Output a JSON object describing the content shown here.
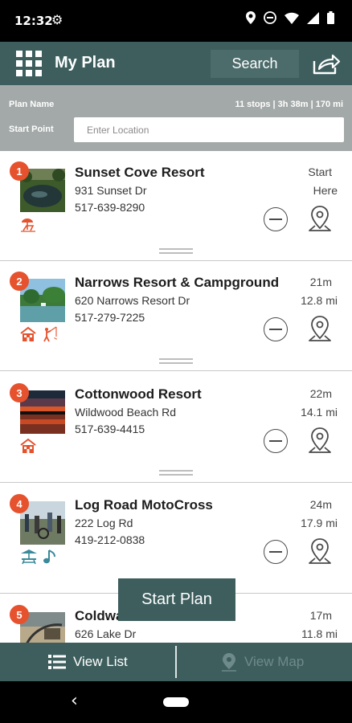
{
  "status_bar": {
    "time": "12:32",
    "icons": [
      "gear-icon",
      "location-icon",
      "do-not-disturb-icon",
      "wifi-icon",
      "signal-icon",
      "battery-icon"
    ]
  },
  "header": {
    "menu_icon": "grid-menu-icon",
    "title": "My Plan",
    "search_label": "Search",
    "share_icon": "share-icon"
  },
  "plan": {
    "name_label": "Plan Name",
    "stats": "11 stops | 3h 38m | 170 mi",
    "start_label": "Start Point",
    "start_placeholder": "Enter Location"
  },
  "stops": [
    {
      "number": "1",
      "name": "Sunset Cove Resort",
      "address": "931 Sunset Dr",
      "phone": "517-639-8290",
      "time": "Start",
      "distance": "Here",
      "amenities": [
        "beach-chair-icon"
      ],
      "amenity_color": "#e5522d"
    },
    {
      "number": "2",
      "name": "Narrows Resort & Campground",
      "address": "620 Narrows Resort Dr",
      "phone": "517-279-7225",
      "time": "21m",
      "distance": "12.8 mi",
      "amenities": [
        "cabin-icon",
        "fishing-icon"
      ],
      "amenity_color": "#e5522d"
    },
    {
      "number": "3",
      "name": "Cottonwood Resort",
      "address": "Wildwood Beach Rd",
      "phone": "517-639-4415",
      "time": "22m",
      "distance": "14.1 mi",
      "amenities": [
        "cabin-icon"
      ],
      "amenity_color": "#e5522d"
    },
    {
      "number": "4",
      "name": "Log Road MotoCross",
      "address": "222 Log Rd",
      "phone": "419-212-0838",
      "time": "24m",
      "distance": "17.9 mi",
      "amenities": [
        "picnic-table-icon",
        "music-icon"
      ],
      "amenity_color": "#3a8a9a"
    },
    {
      "number": "5",
      "name": "Coldwater Lake Marina",
      "address": "626 Lake Dr",
      "phone": "",
      "time": "17m",
      "distance": "11.8 mi",
      "amenities": [],
      "amenity_color": "#e5522d"
    }
  ],
  "start_plan_label": "Start Plan",
  "tabs": {
    "list_label": "View List",
    "map_label": "View Map"
  },
  "colors": {
    "header": "#3e5e5e",
    "plan_bar": "#a3a9a8",
    "badge": "#e5522d",
    "amenity_orange": "#e5522d",
    "amenity_teal": "#3a8a9a"
  }
}
